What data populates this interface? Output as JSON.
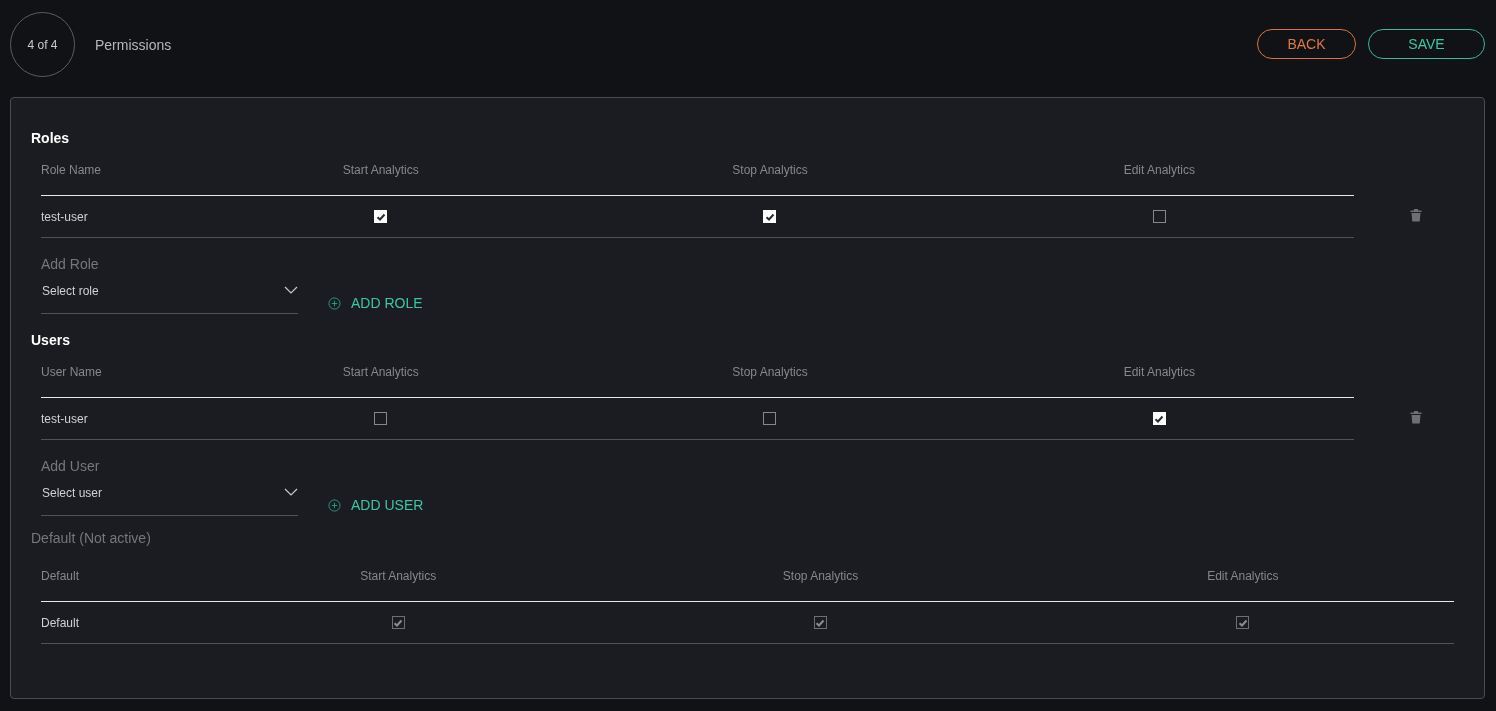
{
  "step": {
    "label": "4 of 4",
    "title": "Permissions"
  },
  "buttons": [
    {
      "label": "BACK",
      "kind": "back"
    },
    {
      "label": "SAVE",
      "kind": "save"
    }
  ],
  "sections": [
    {
      "title": "Roles",
      "columns": [
        "Role Name",
        "Start Analytics",
        "Stop Analytics",
        "Edit Analytics"
      ],
      "rows": [
        {
          "name": "test-user",
          "permissions": [
            {
              "checked": true
            },
            {
              "checked": true
            },
            {
              "checked": false
            }
          ]
        }
      ],
      "add": {
        "label": "Add Role",
        "placeholder": "Select role",
        "button": "ADD ROLE"
      }
    },
    {
      "title": "Users",
      "columns": [
        "User Name",
        "Start Analytics",
        "Stop Analytics",
        "Edit Analytics"
      ],
      "rows": [
        {
          "name": "test-user",
          "permissions": [
            {
              "checked": false
            },
            {
              "checked": false
            },
            {
              "checked": true
            }
          ]
        }
      ],
      "add": {
        "label": "Add User",
        "placeholder": "Select user",
        "button": "ADD USER"
      }
    }
  ],
  "default": {
    "title": "Default (Not active)",
    "columns": [
      "Default",
      "Start Analytics",
      "Stop Analytics",
      "Edit Analytics"
    ],
    "rows": [
      {
        "name": "Default",
        "permissions": [
          {
            "checked": true,
            "disabled": true
          },
          {
            "checked": true,
            "disabled": true
          },
          {
            "checked": true,
            "disabled": true
          }
        ]
      }
    ]
  }
}
